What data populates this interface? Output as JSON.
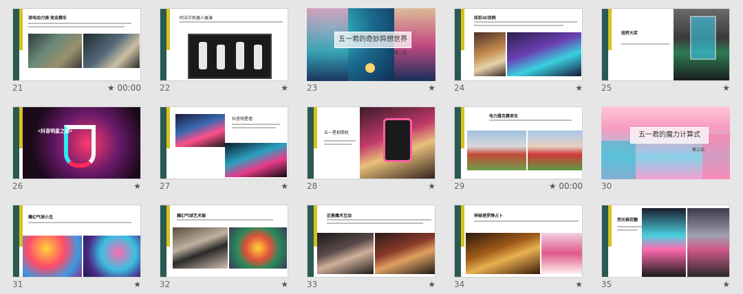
{
  "slides": [
    {
      "num": "21",
      "title": "添电动力骑·竞念赛车",
      "meta": "★ 00:00"
    },
    {
      "num": "22",
      "title": "阿法尔机器人展演",
      "meta": "★"
    },
    {
      "num": "23",
      "title": "五一君的奇妙异想世界",
      "subtitle": "第二站",
      "meta": "★"
    },
    {
      "num": "24",
      "title": "炫彩4D涂鸦",
      "meta": "★"
    },
    {
      "num": "25",
      "title": "扭转大奖",
      "meta": "★"
    },
    {
      "num": "26",
      "title": "<抖音明星之旅>",
      "meta": "★"
    },
    {
      "num": "27",
      "title": "抖音明星墙",
      "meta": "★"
    },
    {
      "num": "28",
      "title": "五一星拍照机",
      "meta": "★"
    },
    {
      "num": "29",
      "title": "电力雅克赛单车",
      "meta": "★ 00:00"
    },
    {
      "num": "30",
      "title": "五一君的魔力计算式",
      "subtitle": "第三站",
      "meta": ""
    },
    {
      "num": "31",
      "title": "魔幻气球小丑",
      "meta": "★"
    },
    {
      "num": "32",
      "title": "魔幻气球艺术展",
      "meta": "★"
    },
    {
      "num": "33",
      "title": "近景魔术互动",
      "meta": "★"
    },
    {
      "num": "34",
      "title": "神秘塔罗牌占卜",
      "meta": "★"
    },
    {
      "num": "35",
      "title": "荧光棉花糖",
      "meta": "★"
    }
  ]
}
